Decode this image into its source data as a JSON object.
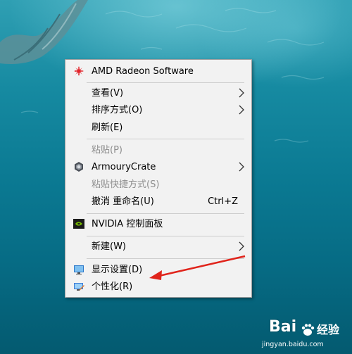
{
  "context_menu": {
    "items": [
      {
        "label": "AMD Radeon Software",
        "icon": "amd-radeon-icon"
      },
      {
        "label": "查看(V)",
        "submenu": true
      },
      {
        "label": "排序方式(O)",
        "submenu": true
      },
      {
        "label": "刷新(E)"
      },
      {
        "label": "粘贴(P)",
        "disabled": true
      },
      {
        "label": "ArmouryCrate",
        "icon": "armoury-crate-icon",
        "submenu": true
      },
      {
        "label": "粘贴快捷方式(S)",
        "disabled": true
      },
      {
        "label": "撤消 重命名(U)",
        "shortcut": "Ctrl+Z"
      },
      {
        "label": "NVIDIA 控制面板",
        "icon": "nvidia-icon"
      },
      {
        "label": "新建(W)",
        "submenu": true
      },
      {
        "label": "显示设置(D)",
        "icon": "display-settings-icon"
      },
      {
        "label": "个性化(R)",
        "icon": "personalize-icon"
      }
    ]
  },
  "colors": {
    "menu_bg": "#f2f2f2",
    "annotation_arrow": "#e0241b",
    "amd_red": "#e3242b",
    "nvidia_green": "#76b900"
  },
  "watermark": {
    "brand": "Bai",
    "site": "经验",
    "url": "jingyan.baidu.com"
  }
}
